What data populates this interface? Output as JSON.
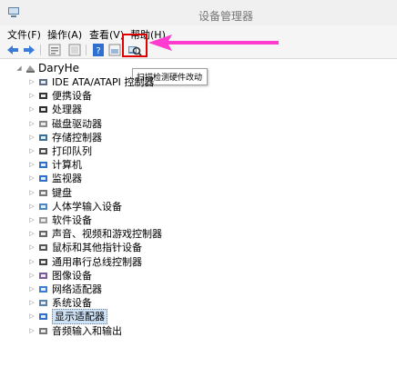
{
  "window": {
    "title": "设备管理器"
  },
  "menu": [
    {
      "label": "文件(F)"
    },
    {
      "label": "操作(A)"
    },
    {
      "label": "查看(V)"
    },
    {
      "label": "帮助(H)"
    }
  ],
  "toolbar": {
    "buttons": [
      {
        "icon": "back-arrow-icon"
      },
      {
        "icon": "forward-arrow-icon"
      },
      {
        "icon": "properties-icon"
      },
      {
        "icon": "show-hidden-icon"
      },
      {
        "icon": "help-icon"
      },
      {
        "icon": "view-icon"
      },
      {
        "icon": "scan-hardware-icon"
      }
    ],
    "highlight_color": "#e00000",
    "arrow_color": "#ff3ccf"
  },
  "tooltip": {
    "text": "扫描检测硬件改动"
  },
  "tree": {
    "root": {
      "label": "DaryHe",
      "expanded": true
    },
    "items": [
      {
        "label": "IDE ATA/ATAPI 控制器",
        "icon": "ide-controller-icon"
      },
      {
        "label": "便携设备",
        "icon": "portable-device-icon"
      },
      {
        "label": "处理器",
        "icon": "processor-icon"
      },
      {
        "label": "磁盘驱动器",
        "icon": "disk-drive-icon"
      },
      {
        "label": "存储控制器",
        "icon": "storage-controller-icon"
      },
      {
        "label": "打印队列",
        "icon": "printer-icon"
      },
      {
        "label": "计算机",
        "icon": "computer-icon"
      },
      {
        "label": "监视器",
        "icon": "monitor-icon"
      },
      {
        "label": "键盘",
        "icon": "keyboard-icon"
      },
      {
        "label": "人体学输入设备",
        "icon": "hid-icon"
      },
      {
        "label": "软件设备",
        "icon": "software-device-icon"
      },
      {
        "label": "声音、视频和游戏控制器",
        "icon": "sound-icon"
      },
      {
        "label": "鼠标和其他指针设备",
        "icon": "mouse-icon"
      },
      {
        "label": "通用串行总线控制器",
        "icon": "usb-icon"
      },
      {
        "label": "图像设备",
        "icon": "imaging-device-icon"
      },
      {
        "label": "网络适配器",
        "icon": "network-adapter-icon"
      },
      {
        "label": "系统设备",
        "icon": "system-device-icon"
      },
      {
        "label": "显示适配器",
        "icon": "display-adapter-icon",
        "selected": true
      },
      {
        "label": "音频输入和输出",
        "icon": "audio-io-icon"
      }
    ]
  }
}
